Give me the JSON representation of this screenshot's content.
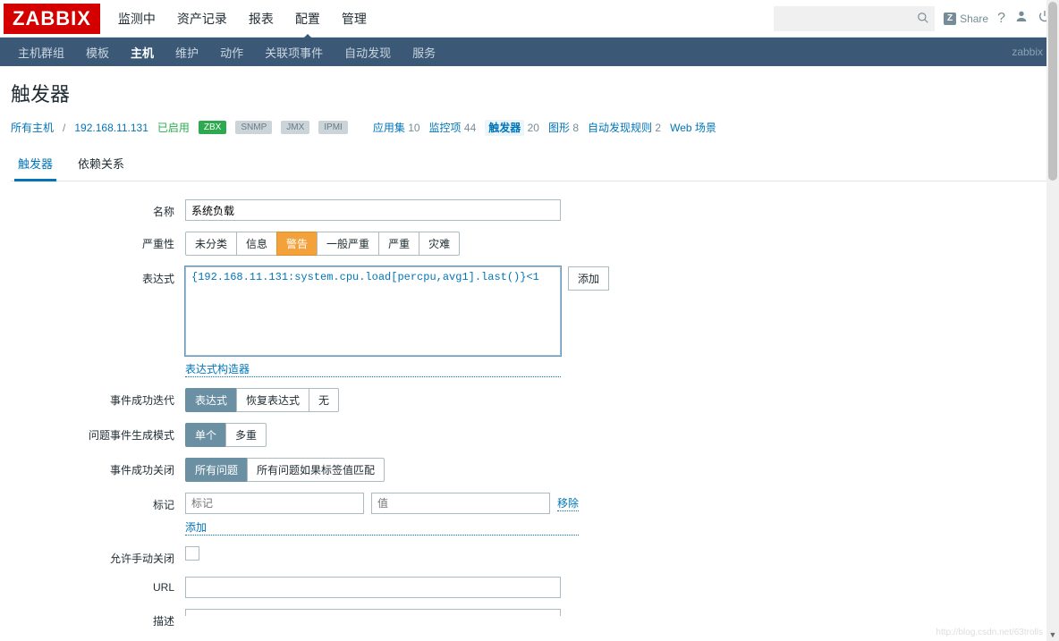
{
  "logo": "ZABBIX",
  "main_menu": [
    "监测中",
    "资产记录",
    "报表",
    "配置",
    "管理"
  ],
  "main_menu_active_index": 3,
  "search": {
    "placeholder": ""
  },
  "share_label": "Share",
  "sub_menu": [
    "主机群组",
    "模板",
    "主机",
    "维护",
    "动作",
    "关联项事件",
    "自动发现",
    "服务"
  ],
  "sub_menu_active_index": 2,
  "sub_brand": "zabbix",
  "page_title": "触发器",
  "breadcrumbs": {
    "all_hosts": "所有主机",
    "host_ip": "192.168.11.131",
    "enabled": "已启用",
    "zbx": "ZBX",
    "snmp": "SNMP",
    "jmx": "JMX",
    "ipmi": "IPMI",
    "items": [
      {
        "label": "应用集",
        "count": "10",
        "selected": false
      },
      {
        "label": "监控项",
        "count": "44",
        "selected": false
      },
      {
        "label": "触发器",
        "count": "20",
        "selected": true
      },
      {
        "label": "图形",
        "count": "8",
        "selected": false
      },
      {
        "label": "自动发现规则",
        "count": "2",
        "selected": false
      },
      {
        "label": "Web 场景",
        "count": "",
        "selected": false
      }
    ]
  },
  "inner_tabs": [
    "触发器",
    "依赖关系"
  ],
  "inner_tab_active_index": 0,
  "form": {
    "name_label": "名称",
    "name_value": "系统负载",
    "severity_label": "严重性",
    "severity_options": [
      "未分类",
      "信息",
      "警告",
      "一般严重",
      "严重",
      "灾难"
    ],
    "severity_selected_index": 2,
    "expression_label": "表达式",
    "expression_value": "{192.168.11.131:system.cpu.load[percpu,avg1].last()}<1",
    "add_btn": "添加",
    "expr_constructor": "表达式构造器",
    "ok_event_label": "事件成功迭代",
    "ok_event_options": [
      "表达式",
      "恢复表达式",
      "无"
    ],
    "ok_event_selected_index": 0,
    "problem_mode_label": "问题事件生成模式",
    "problem_mode_options": [
      "单个",
      "多重"
    ],
    "problem_mode_selected_index": 0,
    "ok_close_label": "事件成功关闭",
    "ok_close_options": [
      "所有问题",
      "所有问题如果标签值匹配"
    ],
    "ok_close_selected_index": 0,
    "tags_label": "标记",
    "tag_name_placeholder": "标记",
    "tag_value_placeholder": "值",
    "tag_remove": "移除",
    "tag_add": "添加",
    "allow_manual_label": "允许手动关闭",
    "url_label": "URL",
    "url_value": "",
    "desc_label": "描述"
  },
  "watermark": "http://blog.csdn.net/63trolls"
}
